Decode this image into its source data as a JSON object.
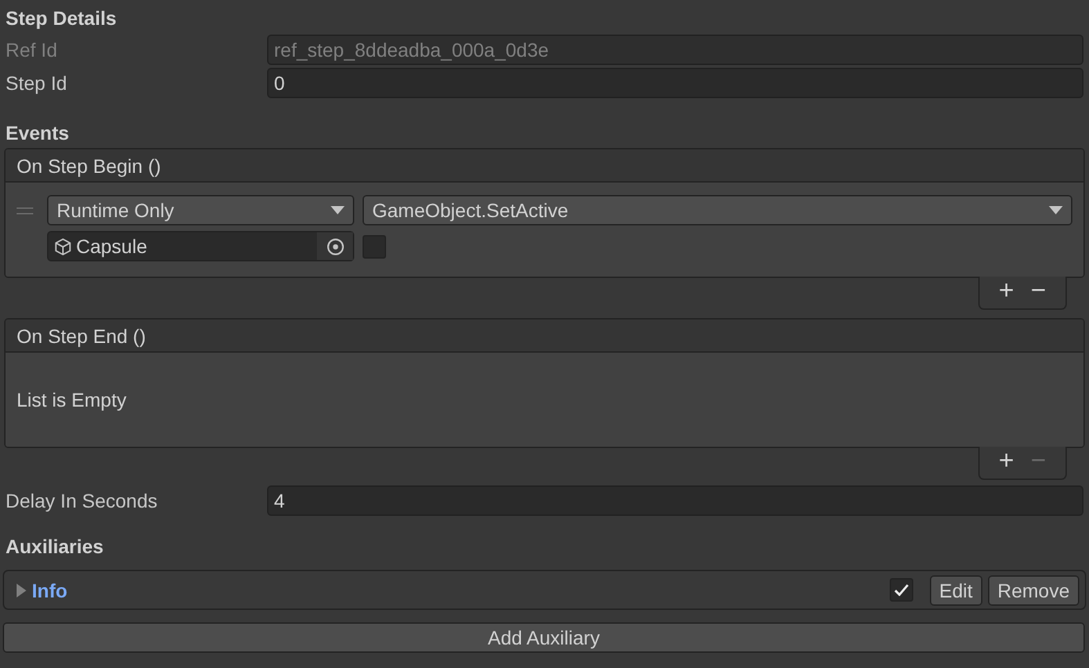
{
  "section_title": "Step Details",
  "fields": [
    {
      "label": "Ref Id",
      "value": "ref_step_8ddeadba_000a_0d3e",
      "disabled": true
    },
    {
      "label": "Step Id",
      "value": "0",
      "disabled": false
    }
  ],
  "events_title": "Events",
  "events": [
    {
      "title": "On Step Begin ()",
      "items": [
        {
          "mode": "Runtime Only",
          "target": "Capsule",
          "function": "GameObject.SetActive",
          "argument_checked": false
        }
      ],
      "add_label": "+",
      "remove_label": "−",
      "remove_disabled": false
    },
    {
      "title": "On Step End ()",
      "empty_text": "List is Empty",
      "add_label": "+",
      "remove_label": "−",
      "remove_disabled": true
    }
  ],
  "delay": {
    "label": "Delay In Seconds",
    "value": "4"
  },
  "auxiliaries": {
    "title": "Auxiliaries",
    "items": [
      {
        "name": "Info",
        "expanded": false,
        "enabled": true,
        "edit_label": "Edit",
        "remove_label": "Remove"
      }
    ],
    "add_button": "Add Auxiliary"
  }
}
